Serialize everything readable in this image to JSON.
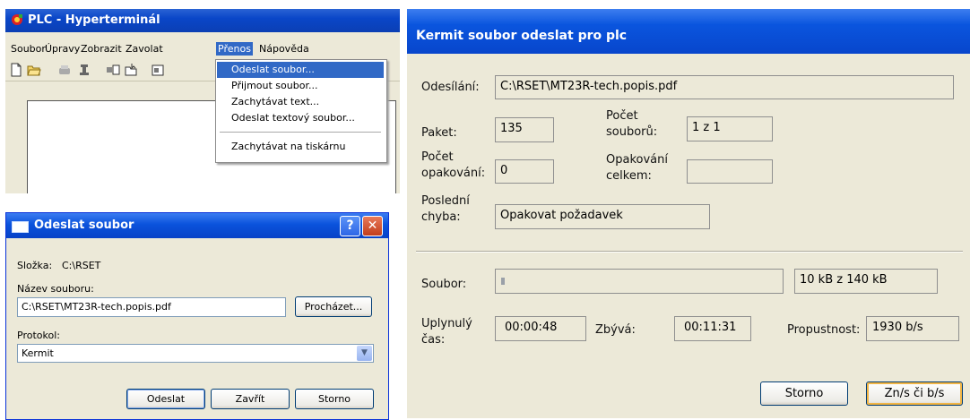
{
  "hyperterminal": {
    "title": "PLC - Hyperterminál",
    "menu": [
      "Soubor",
      "Úpravy",
      "Zobrazit",
      "Zavolat",
      "Přenos",
      "Nápověda"
    ],
    "active_menu_index": 4,
    "toolbar_icons": [
      "new-file-icon",
      "open-folder-icon",
      "call-icon",
      "disconnect-icon",
      "send-icon",
      "receive-icon",
      "properties-icon"
    ],
    "transfer_menu": {
      "items": [
        "Odeslat soubor...",
        "Přijmout soubor...",
        "Zachytávat text...",
        "Odeslat textový soubor...",
        "Zachytávat na tiskárnu"
      ],
      "highlighted_index": 0
    }
  },
  "send_dialog": {
    "title": "Odeslat soubor",
    "help_button": "?",
    "close_button": "✕",
    "folder_label": "Složka:",
    "folder_value": "C:\\RSET",
    "filename_label": "Název souboru:",
    "filename_value": "C:\\RSET\\MT23R-tech.popis.pdf",
    "browse_button": "Procházet...",
    "protocol_label": "Protokol:",
    "protocol_value": "Kermit",
    "buttons": {
      "send": "Odeslat",
      "close": "Zavřít",
      "cancel": "Storno"
    }
  },
  "kermit_dialog": {
    "title": "Kermit soubor odeslat pro plc",
    "sending_label": "Odesílání:",
    "sending_value": "C:\\RSET\\MT23R-tech.popis.pdf",
    "packet_label": "Paket:",
    "packet_value": "135",
    "file_count_label_1": "Počet",
    "file_count_label_2": "souborů:",
    "file_count_value": "1 z 1",
    "retries_label_1": "Počet",
    "retries_label_2": "opakování:",
    "retries_value": "0",
    "total_retries_label_1": "Opakování",
    "total_retries_label_2": "celkem:",
    "total_retries_value": "",
    "last_error_label_1": "Poslední",
    "last_error_label_2": "chyba:",
    "last_error_value": "Opakovat požadavek",
    "file_label": "Soubor:",
    "file_progress": 0.07,
    "file_size_value": "10 kB z 140 kB",
    "elapsed_label_1": "Uplynulý",
    "elapsed_label_2": "čas:",
    "elapsed_value": "00:00:48",
    "remaining_label": "Zbývá:",
    "remaining_value": "00:11:31",
    "throughput_label": "Propustnost:",
    "throughput_value": "1930 b/s",
    "buttons": {
      "cancel": "Storno",
      "toggle_units": "Zn/s či b/s"
    }
  },
  "colors": {
    "xp_title_blue": "#0a52dc",
    "xp_face": "#ece9d8",
    "menu_highlight": "#3169c6",
    "progress_block": "#9aa0a8"
  }
}
